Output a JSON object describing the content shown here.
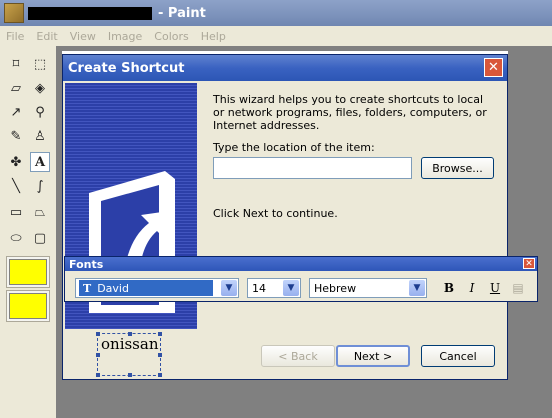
{
  "window": {
    "title": "- Paint"
  },
  "menu": [
    "File",
    "Edit",
    "View",
    "Image",
    "Colors",
    "Help"
  ],
  "toolbox": {
    "tools": [
      "free-select-icon",
      "rect-select-icon",
      "eraser-icon",
      "fill-icon",
      "color-picker-icon",
      "magnifier-icon",
      "pencil-icon",
      "brush-icon",
      "airbrush-icon",
      "text-icon",
      "line-icon",
      "curve-icon",
      "rectangle-icon",
      "polygon-icon",
      "ellipse-icon",
      "rounded-rect-icon"
    ],
    "selected": "text-icon"
  },
  "dialog": {
    "title": "Create Shortcut",
    "body": "This wizard helps you to create shortcuts to local or network programs, files, folders, computers, or Internet addresses.",
    "location_label": "Type the location of the item:",
    "location_value": "",
    "browse": "Browse...",
    "next_hint": "Click Next to continue.",
    "back": "< Back",
    "next": "Next >",
    "cancel": "Cancel"
  },
  "fonts_toolbar": {
    "title": "Fonts",
    "font": "David",
    "size": "14",
    "script": "Hebrew",
    "bold": "B",
    "italic": "I",
    "underline": "U"
  },
  "canvas": {
    "text": "onissan"
  },
  "colors": {
    "accent": "#316ac5",
    "title": "#2c56b5"
  }
}
